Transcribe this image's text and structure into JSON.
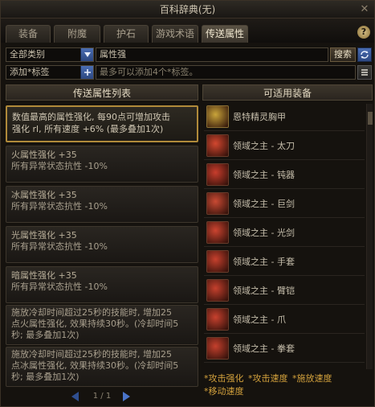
{
  "window": {
    "title": "百科辞典(无)",
    "close_glyph": "✕"
  },
  "tabs": [
    {
      "label": "装备",
      "active": false
    },
    {
      "label": "附魔",
      "active": false
    },
    {
      "label": "护石",
      "active": false
    },
    {
      "label": "游戏术语",
      "active": false
    },
    {
      "label": "传送属性",
      "active": true
    }
  ],
  "help": {
    "glyph": "?"
  },
  "filters_row": {
    "category_select": "全部类别",
    "search_value": "属性强",
    "search_button": "搜索",
    "tag_select": "添加*标签",
    "tag_placeholder": "最多可以添加4个*标签。"
  },
  "left_panel": {
    "header": "传送属性列表"
  },
  "cards": [
    {
      "selected": true,
      "line1": "数值最高的属性强化, 每90点可增加攻击",
      "line2": "强化 rl, 所有速度 +6% (最多叠加1次)"
    },
    {
      "selected": false,
      "line1": "火属性强化 +35",
      "line2": "所有异常状态抗性 -10%"
    },
    {
      "selected": false,
      "line1": "冰属性强化 +35",
      "line2": "所有异常状态抗性 -10%"
    },
    {
      "selected": false,
      "line1": "光属性强化 +35",
      "line2": "所有异常状态抗性 -10%"
    },
    {
      "selected": false,
      "line1": "暗属性强化 +35",
      "line2": "所有异常状态抗性 -10%"
    },
    {
      "selected": false,
      "line1": "施放冷却时间超过25秒的技能时, 增加25",
      "line2": "点火属性强化, 效果持续30秒。(冷却时间5",
      "line3": "秒; 最多叠加1次)"
    },
    {
      "selected": false,
      "line1": "施放冷却时间超过25秒的技能时, 增加25",
      "line2": "点冰属性强化, 效果持续30秒。(冷却时间5",
      "line3": "秒; 最多叠加1次)"
    }
  ],
  "pager": {
    "text": "1 / 1"
  },
  "right_panel": {
    "header": "可适用装备"
  },
  "equipment": [
    {
      "name": "恩特精灵胸甲",
      "icon": "armor-icon",
      "color": "#c9a43a"
    },
    {
      "name": "领域之主 - 太刀",
      "icon": "katana-icon",
      "color": "#d2472f"
    },
    {
      "name": "领域之主 - 钝器",
      "icon": "mace-icon",
      "color": "#c83d2c"
    },
    {
      "name": "领域之主 - 巨剑",
      "icon": "greatsword-icon",
      "color": "#c94a33"
    },
    {
      "name": "领域之主 - 光剑",
      "icon": "lightsaber-icon",
      "color": "#cc4430"
    },
    {
      "name": "领域之主 - 手套",
      "icon": "gauntlet-icon",
      "color": "#c6402d"
    },
    {
      "name": "领域之主 - 臂铠",
      "icon": "armguard-icon",
      "color": "#c5402d"
    },
    {
      "name": "领域之主 - 爪",
      "icon": "claw-icon",
      "color": "#c8412e"
    },
    {
      "name": "领域之主 - 拳套",
      "icon": "fist-icon",
      "color": "#c5402d"
    }
  ],
  "stat_filters": [
    "*攻击强化",
    "*攻击速度",
    "*施放速度",
    "*移动速度"
  ],
  "colors": {
    "accent_gold": "#b08a3a",
    "filter_text": "#d3a13c",
    "blue_button": "#4a6db3"
  }
}
